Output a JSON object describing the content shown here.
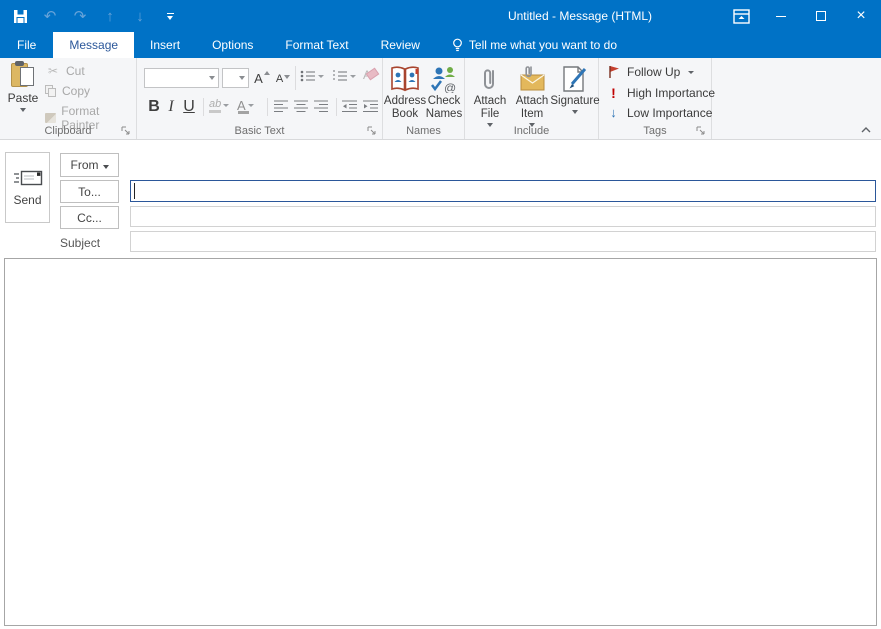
{
  "window": {
    "title": "Untitled  -  Message (HTML)"
  },
  "colors": {
    "titlebar_blue": "#0072c6",
    "titlebar_decor_blue": "#0b62aa",
    "active_tab_text": "#2b579a",
    "focused_field_border": "#2b579a",
    "flag_red": "#c5402e",
    "high_importance_red": "#c00000",
    "low_importance_blue": "#2e75b6",
    "paste_clipboard_tan": "#dcb763"
  },
  "icons": {
    "undo": "↶",
    "redo": "↷",
    "previous_item": "↑",
    "next_item": "↓",
    "cut": "✂",
    "minimize": "–",
    "close": "×",
    "highlight_text": "ab",
    "font_color_letter": "A",
    "grow_font_letter": "A",
    "shrink_font_letter": "A",
    "at_sign": "@",
    "check_mark": "✓",
    "high_importance_mark": "!",
    "low_importance_arrow": "↓"
  },
  "tabs": {
    "items": [
      {
        "label": "File",
        "active": false
      },
      {
        "label": "Message",
        "active": true
      },
      {
        "label": "Insert",
        "active": false
      },
      {
        "label": "Options",
        "active": false
      },
      {
        "label": "Format Text",
        "active": false
      },
      {
        "label": "Review",
        "active": false
      }
    ],
    "tellme": "Tell me what you want to do"
  },
  "ribbon": {
    "clipboard": {
      "group_label": "Clipboard",
      "paste": "Paste",
      "cut": "Cut",
      "copy": "Copy",
      "format_painter": "Format Painter"
    },
    "basic_text": {
      "group_label": "Basic Text",
      "font_name_value": "",
      "font_size_value": "",
      "bold": "B",
      "italic": "I",
      "underline": "U"
    },
    "names": {
      "group_label": "Names",
      "address_book": "Address Book",
      "check_names": "Check Names"
    },
    "include": {
      "group_label": "Include",
      "attach_file": "Attach File",
      "attach_item": "Attach Item",
      "signature": "Signature"
    },
    "tags": {
      "group_label": "Tags",
      "follow_up": "Follow Up",
      "high_importance": "High Importance",
      "low_importance": "Low Importance"
    }
  },
  "compose": {
    "send_label": "Send",
    "from_label": "From",
    "to_label": "To...",
    "cc_label": "Cc...",
    "subject_label": "Subject",
    "to_value": "",
    "cc_value": "",
    "subject_value": "",
    "body_value": ""
  }
}
